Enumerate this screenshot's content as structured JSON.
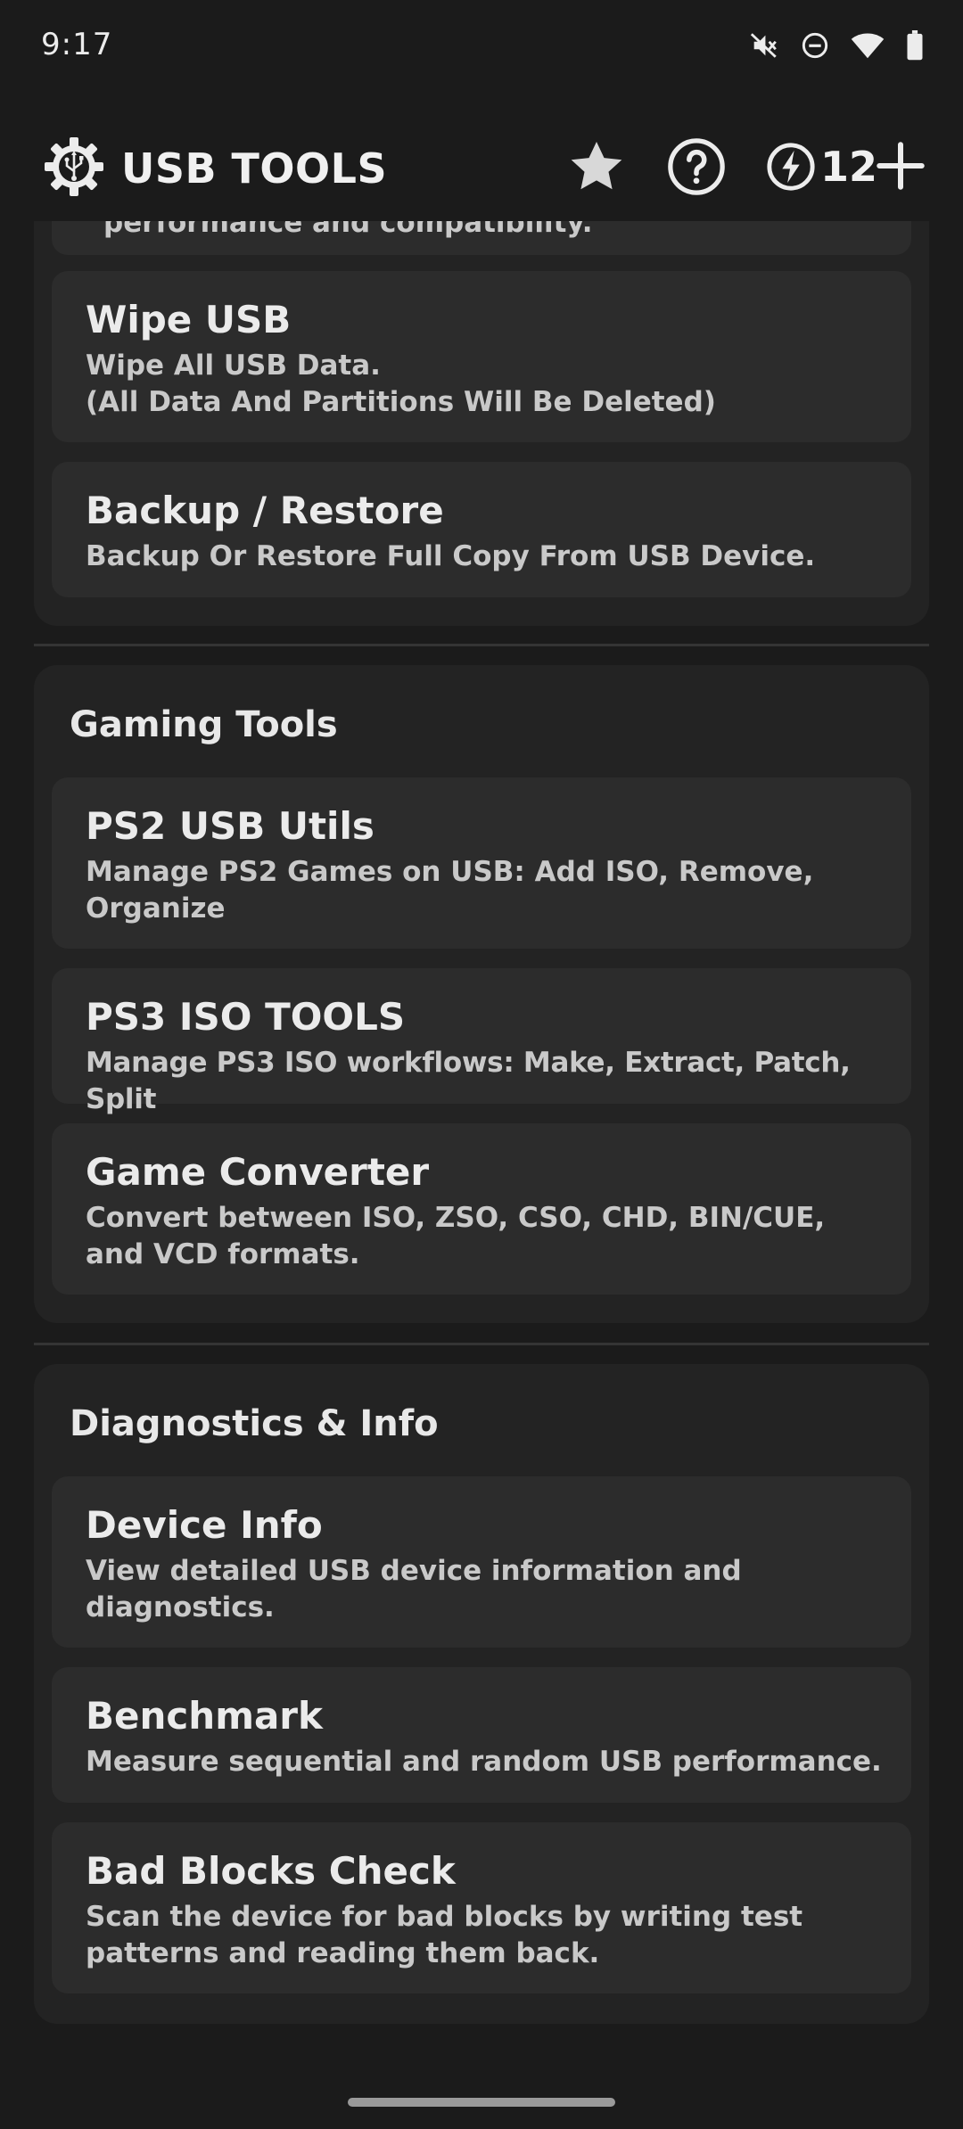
{
  "status_bar": {
    "time": "9:17",
    "icons": [
      "mute-icon",
      "do-not-disturb-icon",
      "wifi-icon",
      "battery-icon"
    ]
  },
  "app_bar": {
    "title": "USB TOOLS",
    "logo_icon": "usb-gear-icon",
    "credits": "12",
    "actions": [
      "star-icon",
      "help-icon",
      "bolt-icon",
      "plus-icon"
    ]
  },
  "colors": {
    "background": "#1b1b1b",
    "section": "#232323",
    "card": "#2c2c2c",
    "text": "#ebebeb",
    "subtext": "#c9c9c9"
  },
  "partial_card": {
    "desc": "performance and compatibility."
  },
  "sections": [
    {
      "title": "",
      "items": [
        {
          "title": "Wipe USB",
          "desc": "Wipe All USB Data.",
          "desc2": "(All Data And Partitions Will Be Deleted)"
        },
        {
          "title": "Backup / Restore",
          "desc": "Backup Or Restore Full Copy From USB Device."
        }
      ]
    },
    {
      "title": "Gaming Tools",
      "items": [
        {
          "title": "PS2 USB Utils",
          "desc": "Manage PS2 Games on USB: Add ISO, Remove, Organize"
        },
        {
          "title": "PS3 ISO TOOLS",
          "desc": "Manage PS3 ISO workflows: Make, Extract, Patch, Split"
        },
        {
          "title": "Game Converter",
          "desc": "Convert between ISO, ZSO, CSO, CHD, BIN/CUE, and VCD formats."
        }
      ]
    },
    {
      "title": "Diagnostics & Info",
      "items": [
        {
          "title": "Device Info",
          "desc": "View detailed USB device information and diagnostics."
        },
        {
          "title": "Benchmark",
          "desc": "Measure sequential and random USB performance."
        },
        {
          "title": "Bad Blocks Check",
          "desc": "Scan the device for bad blocks by writing test patterns and reading them back."
        }
      ]
    }
  ]
}
